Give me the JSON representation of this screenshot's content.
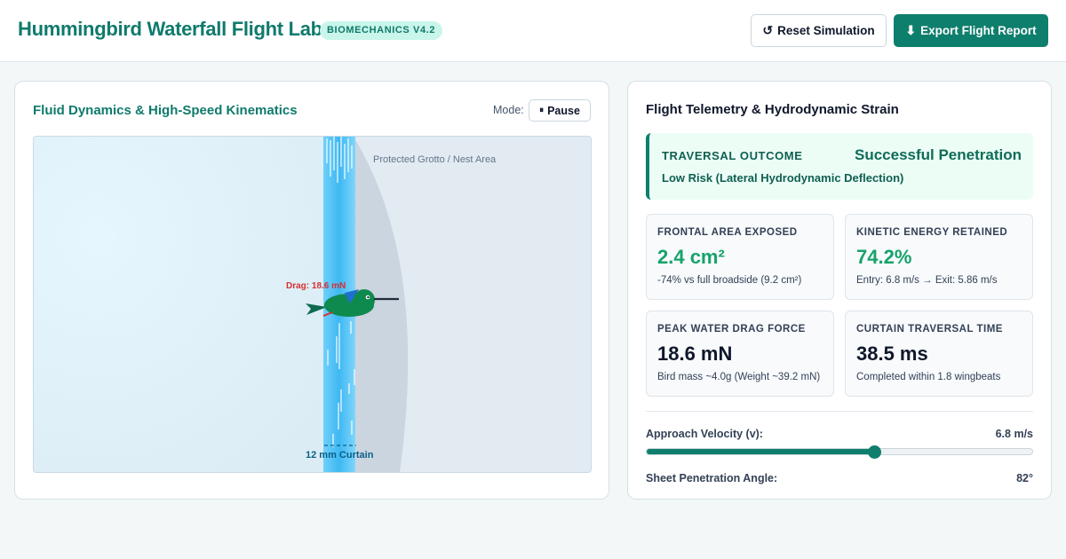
{
  "header": {
    "title": "Hummingbird Waterfall Flight Lab",
    "badge": "BIOMECHANICS V4.2",
    "reset_label": "Reset Simulation",
    "reset_icon": "↺",
    "export_label": "Export Flight Report",
    "export_icon": "⬇"
  },
  "sim_panel": {
    "title": "Fluid Dynamics & High-Speed Kinematics",
    "mode_label": "Mode:",
    "pause_label": "Pause",
    "pause_icon": "⏸",
    "grotto_label": "Protected Grotto / Nest Area",
    "drag_label": "Drag: 18.6 mN",
    "curtain_label": "12 mm Curtain",
    "colors": {
      "water": "#4fc3f7",
      "bird": "#0f8a4f",
      "drag": "#d63031"
    }
  },
  "telemetry": {
    "title": "Flight Telemetry & Hydrodynamic Strain",
    "outcome": {
      "label": "TRAVERSAL OUTCOME",
      "value": "Successful Penetration",
      "risk": "Low Risk (Lateral Hydrodynamic Deflection)"
    },
    "metrics": [
      {
        "label": "FRONTAL AREA EXPOSED",
        "value": "2.4 cm²",
        "sub": "-74% vs full broadside (9.2 cm²)"
      },
      {
        "label": "KINETIC ENERGY RETAINED",
        "value": "74.2%",
        "sub": "Entry: 6.8 m/s → Exit: 5.86 m/s"
      },
      {
        "label": "PEAK WATER DRAG FORCE",
        "value": "18.6 mN",
        "sub": "Bird mass ~4.0g (Weight ~39.2 mN)"
      },
      {
        "label": "CURTAIN TRAVERSAL TIME",
        "value": "38.5 ms",
        "sub": "Completed within 1.8 wingbeats"
      }
    ],
    "controls": {
      "velocity_label": "Approach Velocity (v):",
      "velocity_value": "6.8 m/s",
      "velocity_fraction": 0.59,
      "angle_label": "Sheet Penetration Angle:",
      "angle_value": "82°"
    }
  }
}
